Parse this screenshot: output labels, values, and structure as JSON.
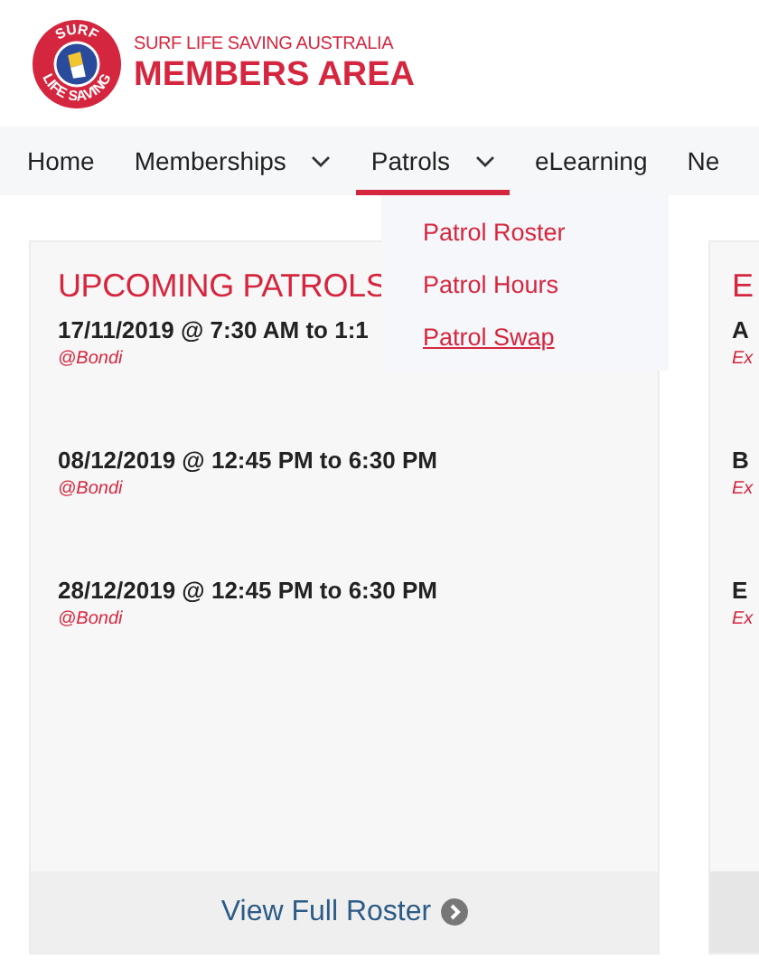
{
  "header": {
    "org": "SURF LIFE SAVING AUSTRALIA",
    "title": "MEMBERS AREA",
    "logo_text": [
      "SURF",
      "LIFE SAVING"
    ]
  },
  "nav": [
    {
      "label": "Home",
      "dropdown": false,
      "selected": false
    },
    {
      "label": "Memberships",
      "dropdown": true,
      "selected": false
    },
    {
      "label": "Patrols",
      "dropdown": true,
      "selected": true
    },
    {
      "label": "eLearning",
      "dropdown": false,
      "selected": false
    },
    {
      "label": "Ne",
      "dropdown": false,
      "selected": false
    }
  ],
  "menu": [
    {
      "label": "Patrol Roster",
      "hovered": false
    },
    {
      "label": "Patrol Hours",
      "hovered": false
    },
    {
      "label": "Patrol Swap",
      "hovered": true
    }
  ],
  "cards": [
    {
      "title": "UPCOMING PATROLS",
      "entries": [
        {
          "time": "17/11/2019 @ 7:30 AM to 1:1",
          "place": "@Bondi"
        },
        {
          "time": "08/12/2019 @ 12:45 PM to 6:30 PM",
          "place": "@Bondi"
        },
        {
          "time": "28/12/2019 @ 12:45 PM to 6:30 PM",
          "place": "@Bondi"
        }
      ],
      "footer_link": "View Full Roster"
    },
    {
      "title": "E",
      "entries": [
        {
          "time": "A",
          "place": "Ex"
        },
        {
          "time": "B",
          "place": "Ex"
        },
        {
          "time": "E",
          "place": "Ex"
        }
      ]
    }
  ]
}
